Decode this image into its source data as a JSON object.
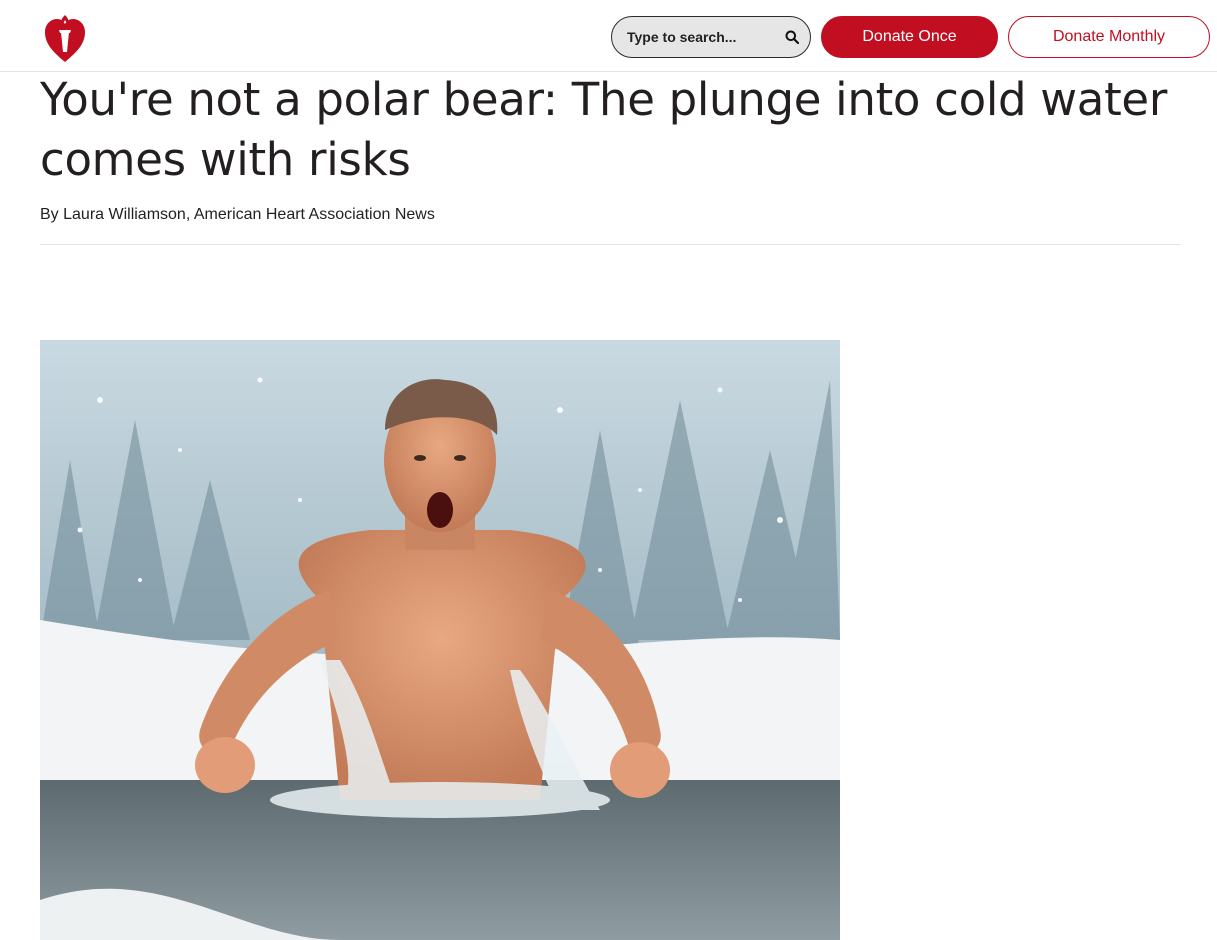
{
  "header": {
    "logo_name": "American Heart Association",
    "search": {
      "placeholder": "Type to search...",
      "icon": "search-icon"
    },
    "donate_once_label": "Donate Once",
    "donate_monthly_label": "Donate Monthly",
    "brand_color": "#c10e21"
  },
  "article": {
    "title": "You're not a polar bear: The plunge into cold water comes with risks",
    "byline": "By Laura Williamson, American Heart Association News"
  }
}
